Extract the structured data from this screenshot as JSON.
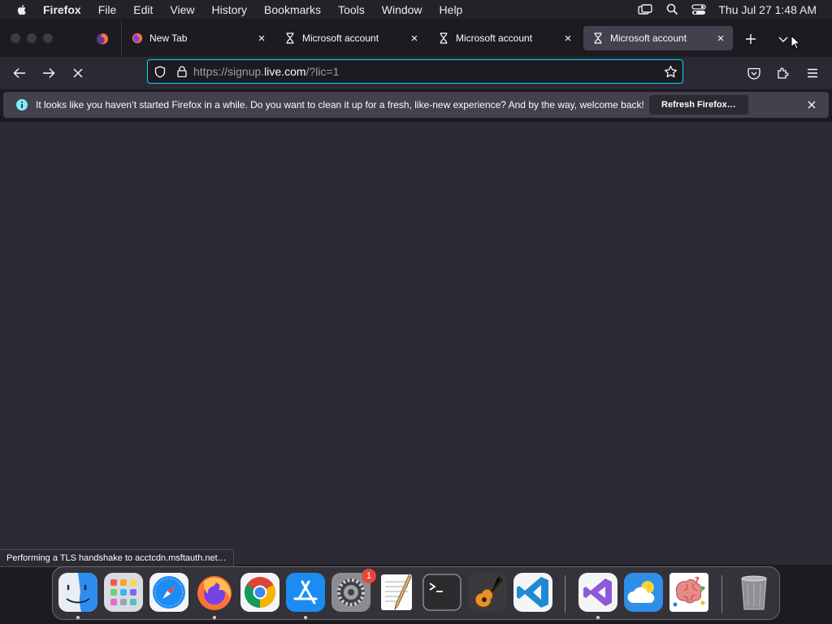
{
  "menubar": {
    "app_name": "Firefox",
    "items": [
      "File",
      "Edit",
      "View",
      "History",
      "Bookmarks",
      "Tools",
      "Window",
      "Help"
    ],
    "clock": "Thu Jul 27  1:48 AM"
  },
  "tabs": [
    {
      "label": "New Tab",
      "icon": "firefox-icon"
    },
    {
      "label": "Microsoft account",
      "icon": "hourglass-icon"
    },
    {
      "label": "Microsoft account",
      "icon": "hourglass-icon"
    },
    {
      "label": "Microsoft account",
      "icon": "hourglass-icon",
      "active": true
    }
  ],
  "urlbar": {
    "url_prefix": "https://signup.",
    "url_domain": "live.com",
    "url_suffix": "/?lic=1"
  },
  "notification": {
    "message": "It looks like you haven’t started Firefox in a while. Do you want to clean it up for a fresh, like-new experience? And by the way, welcome back!",
    "button": "Refresh Firefox…"
  },
  "status": "Performing a TLS handshake to acctcdn.msftauth.net…",
  "dock": {
    "apps": [
      "finder",
      "launchpad",
      "safari",
      "firefox",
      "chrome",
      "app-store",
      "system-settings",
      "textedit",
      "terminal",
      "garageband",
      "vscode",
      "visual-studio",
      "weather",
      "brain-game",
      "trash"
    ],
    "settings_badge": "1"
  },
  "colors": {
    "accent": "#00ddff",
    "toolbar": "#2b2a33",
    "tab_active": "#42414d"
  }
}
